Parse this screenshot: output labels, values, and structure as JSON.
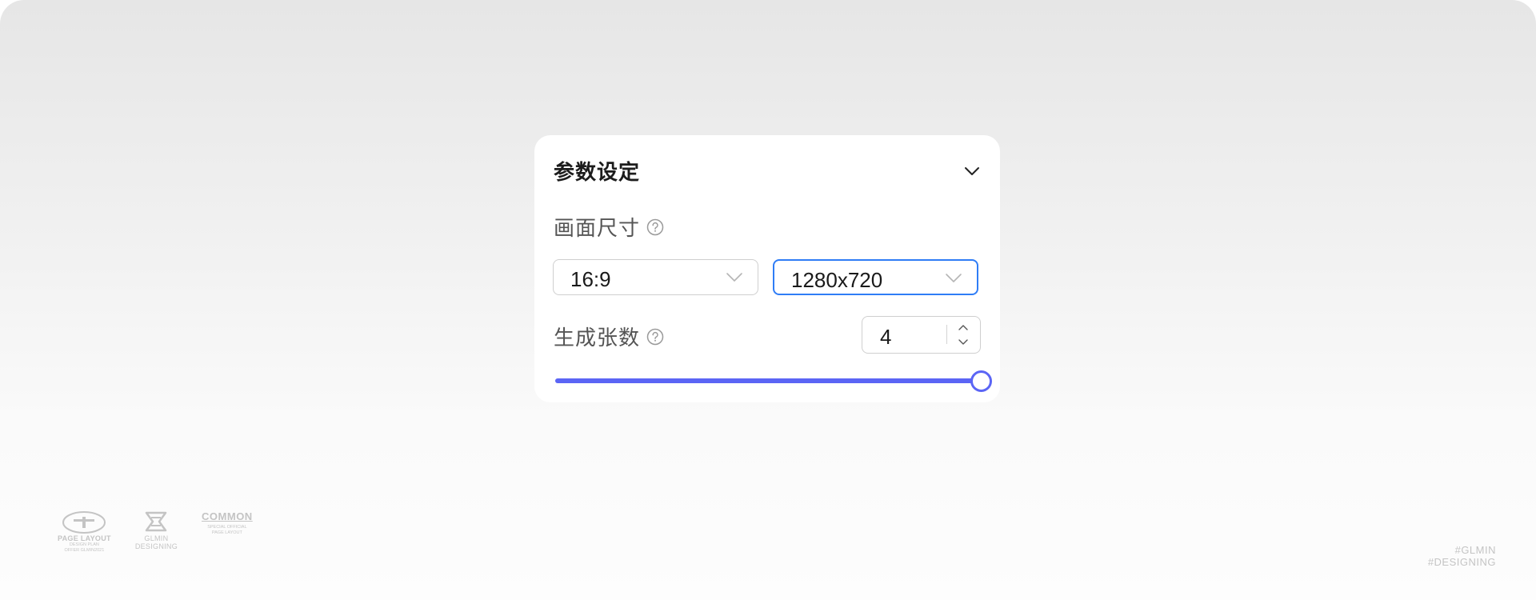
{
  "panel": {
    "title": "参数设定",
    "size_field": {
      "label": "画面尺寸",
      "ratio_select": {
        "value": "16:9"
      },
      "resolution_select": {
        "value": "1280x720",
        "focused": true
      }
    },
    "count_field": {
      "label": "生成张数",
      "stepper_value": "4",
      "slider": {
        "value_fraction": 1.0
      }
    }
  },
  "watermark": {
    "logo1": {
      "main": "PAGE LAYOUT",
      "sub1": "DESIGN PLAN",
      "sub2": "OFFER GLMIN2021"
    },
    "logo2": {
      "main1": "GLMIN",
      "main2": "DESIGNING"
    },
    "logo3": {
      "main": "COMMON",
      "sub1": "SPECIAL OFFICIAL",
      "sub2": "PAGE LAYOUT"
    },
    "tags": [
      "#GLMIN",
      "#DESIGNING"
    ]
  },
  "colors": {
    "accent": "#5b65f5",
    "focus_border": "#2f7df6",
    "panel_bg": "#ffffff"
  },
  "icons": {
    "collapse": "chevron-down-icon",
    "help": "question-circle-icon",
    "select_arrow": "chevron-down-icon",
    "step_up": "chevron-up-icon",
    "step_down": "chevron-down-icon"
  }
}
